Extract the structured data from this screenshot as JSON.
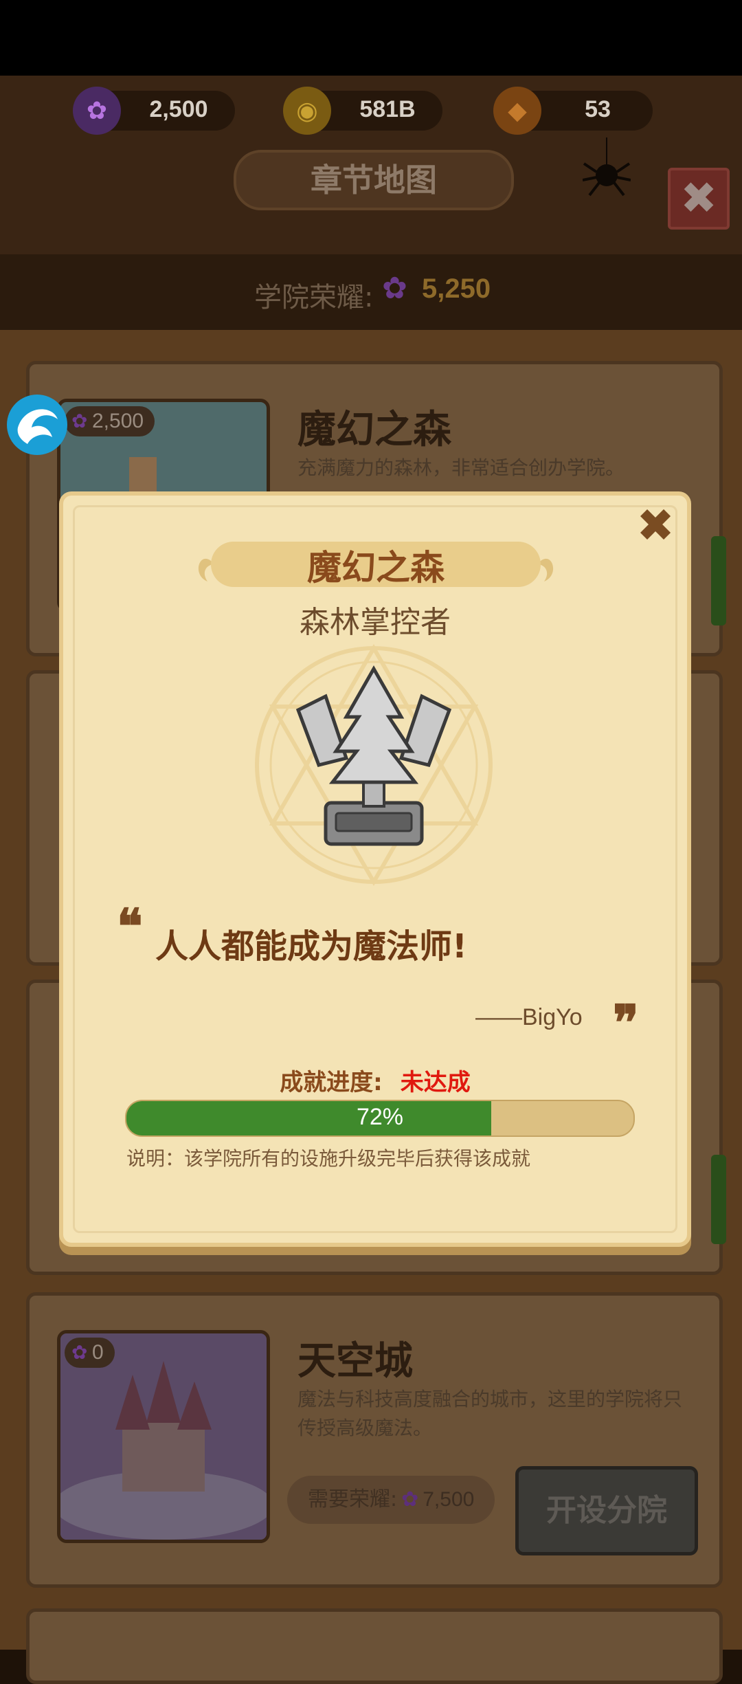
{
  "currencies": {
    "flowers": "2,500",
    "gold": "581B",
    "gems": "53"
  },
  "header": {
    "title": "章节地图",
    "honor_label": "学院荣耀:",
    "honor_value": "5,250"
  },
  "cards": [
    {
      "name": "魔幻之森",
      "description": "充满魔力的森林，非常适合创办学院。",
      "cost": "2,500"
    },
    {
      "name": "天空城",
      "description": "魔法与科技高度融合的城市，这里的学院将只传授高级魔法。",
      "cost": "0",
      "requirement_label": "需要荣耀:",
      "requirement_value": "7,500",
      "button": "开设分院"
    }
  ],
  "modal": {
    "title": "魔幻之森",
    "subtitle": "森林掌控者",
    "quote_open": "❝",
    "motto": "人人都能成为魔法师!",
    "author": "——BigYo",
    "quote_close": "❞",
    "progress_label": "成就进度:",
    "progress_status": "未达成",
    "progress_text": "72%",
    "progress_fraction": 0.72,
    "note": "说明：该学院所有的设施升级完毕后获得该成就"
  },
  "colors": {
    "progress_fill": "#3f8a2c",
    "status_red": "#e0190f",
    "modal_bg": "#f4e3b5"
  }
}
